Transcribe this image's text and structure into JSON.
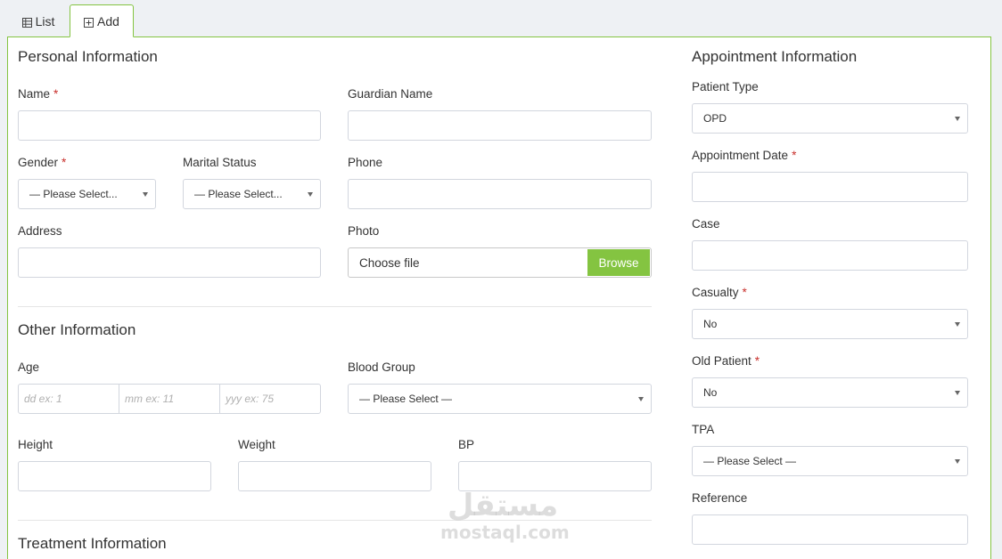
{
  "tabs": {
    "list_label": "List",
    "add_label": "Add"
  },
  "personal": {
    "heading": "Personal Information",
    "name_label": "Name",
    "guardian_label": "Guardian Name",
    "gender_label": "Gender",
    "gender_value": "— Please Select...",
    "marital_label": "Marital Status",
    "marital_value": "— Please Select...",
    "phone_label": "Phone",
    "address_label": "Address",
    "photo_label": "Photo",
    "file_text": "Choose file",
    "browse_label": "Browse"
  },
  "other": {
    "heading": "Other Information",
    "age_label": "Age",
    "age_dd_placeholder": "dd ex: 1",
    "age_mm_placeholder": "mm ex: 11",
    "age_yy_placeholder": "yyy ex: 75",
    "blood_label": "Blood Group",
    "blood_value": "— Please Select —",
    "height_label": "Height",
    "weight_label": "Weight",
    "bp_label": "BP"
  },
  "treatment": {
    "heading": "Treatment Information"
  },
  "appointment": {
    "heading": "Appointment Information",
    "patient_type_label": "Patient Type",
    "patient_type_value": "OPD",
    "date_label": "Appointment Date",
    "case_label": "Case",
    "casualty_label": "Casualty",
    "casualty_value": "No",
    "old_patient_label": "Old Patient",
    "old_patient_value": "No",
    "tpa_label": "TPA",
    "tpa_value": "— Please Select —",
    "reference_label": "Reference"
  },
  "required_mark": "*",
  "watermark": {
    "arabic": "مستقل",
    "latin": "mostaql.com"
  },
  "colors": {
    "accent": "#84c441",
    "required": "#c9302c",
    "border": "#d2d6de"
  }
}
